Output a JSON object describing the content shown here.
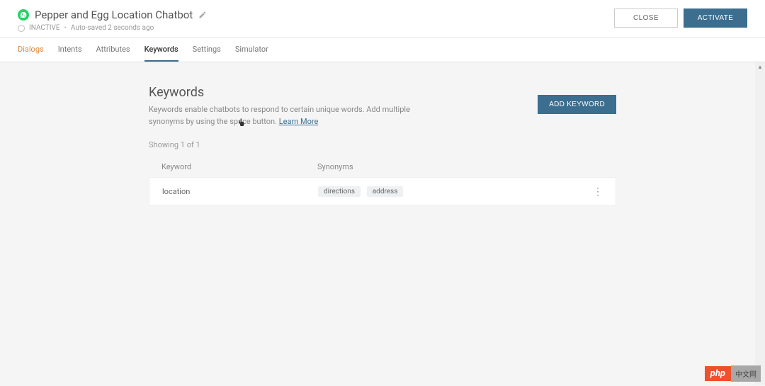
{
  "header": {
    "title": "Pepper and Egg Location Chatbot",
    "status": "INACTIVE",
    "autosave": "Auto-saved 2 seconds ago",
    "close_label": "CLOSE",
    "activate_label": "ACTIVATE"
  },
  "tabs": {
    "dialogs": "Dialogs",
    "intents": "Intents",
    "attributes": "Attributes",
    "keywords": "Keywords",
    "settings": "Settings",
    "simulator": "Simulator"
  },
  "section": {
    "title": "Keywords",
    "description": "Keywords enable chatbots to respond to certain unique words. Add multiple synonyms by using the space button. ",
    "learn_more": "Learn More",
    "add_button": "ADD KEYWORD",
    "showing": "Showing 1 of 1"
  },
  "table": {
    "head_keyword": "Keyword",
    "head_synonyms": "Synonyms",
    "rows": [
      {
        "keyword": "location",
        "synonyms": [
          "directions",
          "address"
        ]
      }
    ]
  },
  "watermark": {
    "left": "php",
    "right": "中文网"
  },
  "colors": {
    "accent": "#3c6e8f",
    "dialogs_tab": "#e08a3c",
    "whatsapp": "#25d366",
    "wm_red": "#f0502d"
  }
}
